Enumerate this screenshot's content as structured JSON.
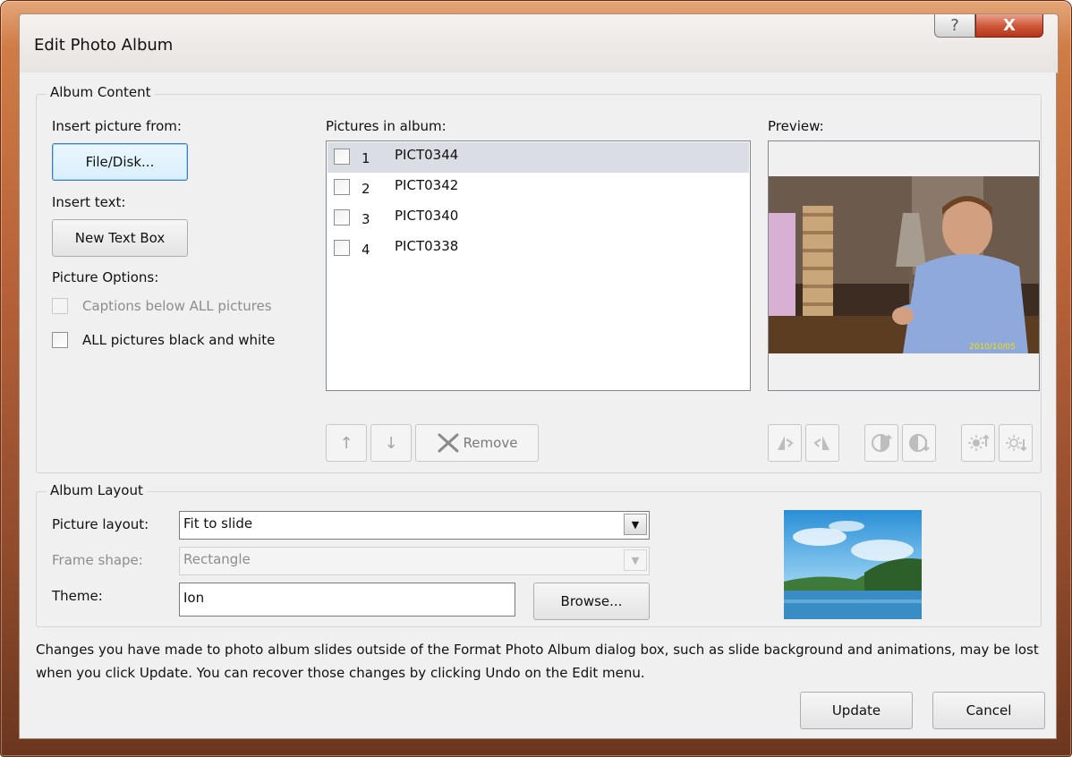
{
  "dialog": {
    "title": "Edit Photo Album",
    "help_glyph": "?",
    "close_glyph": "X"
  },
  "album_content": {
    "group_label": "Album Content",
    "insert_picture_label": "Insert picture from:",
    "file_disk_button": "File/Disk...",
    "insert_text_label": "Insert text:",
    "new_text_box_button": "New Text Box",
    "picture_options_label": "Picture Options:",
    "captions_option": "Captions below ALL pictures",
    "black_white_option": "ALL pictures black and white",
    "pictures_in_album_label": "Pictures in album:",
    "pictures": [
      {
        "num": "1",
        "name": "PICT0344"
      },
      {
        "num": "2",
        "name": "PICT0342"
      },
      {
        "num": "3",
        "name": "PICT0340"
      },
      {
        "num": "4",
        "name": "PICT0338"
      }
    ],
    "move_up_glyph": "↑",
    "move_down_glyph": "↓",
    "remove_button": "Remove",
    "preview_label": "Preview:",
    "preview_date_stamp": "2010/10/05",
    "preview_tools": [
      "rotate-left-icon",
      "rotate-right-icon",
      "contrast-up-icon",
      "contrast-down-icon",
      "brightness-up-icon",
      "brightness-down-icon"
    ]
  },
  "album_layout": {
    "group_label": "Album Layout",
    "picture_layout_label": "Picture layout:",
    "picture_layout_value": "Fit to slide",
    "frame_shape_label": "Frame shape:",
    "frame_shape_value": "Rectangle",
    "theme_label": "Theme:",
    "theme_value": "Ion",
    "browse_button": "Browse..."
  },
  "footer": {
    "notice": "Changes you have made to photo album slides outside of the Format Photo Album dialog box, such as slide background and animations, may be lost when you click Update. You can recover those changes by clicking Undo on the Edit menu.",
    "update_button": "Update",
    "cancel_button": "Cancel"
  },
  "colors": {
    "frame_accent": "#b9633a",
    "close_button": "#cf5a3b",
    "selection": "#dadde3"
  }
}
